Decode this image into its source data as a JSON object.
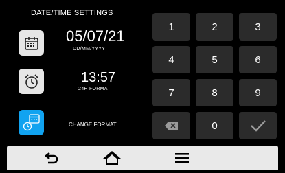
{
  "header": {
    "title": "DATE/TIME SETTINGS"
  },
  "date": {
    "value": "05/07/21",
    "format": "DD/MM/YYYY",
    "icon": "calendar-icon"
  },
  "time": {
    "value": "13:57",
    "format": "24H FORMAT",
    "icon": "alarm-clock-icon"
  },
  "change_format": {
    "label": "CHANGE FORMAT",
    "icon": "calendar-clock-icon",
    "accent": "#11a3f0"
  },
  "keypad": {
    "keys": [
      "1",
      "2",
      "3",
      "4",
      "5",
      "6",
      "7",
      "8",
      "9"
    ],
    "zero": "0",
    "backspace_icon": "backspace-icon",
    "confirm_icon": "checkmark-icon"
  },
  "bottom_nav": {
    "back_icon": "back-arrow-icon",
    "home_icon": "home-icon",
    "menu_icon": "menu-icon"
  },
  "colors": {
    "background": "#000000",
    "key_background": "#2b2b2b",
    "bottom_bar": "#e9e9e9"
  }
}
